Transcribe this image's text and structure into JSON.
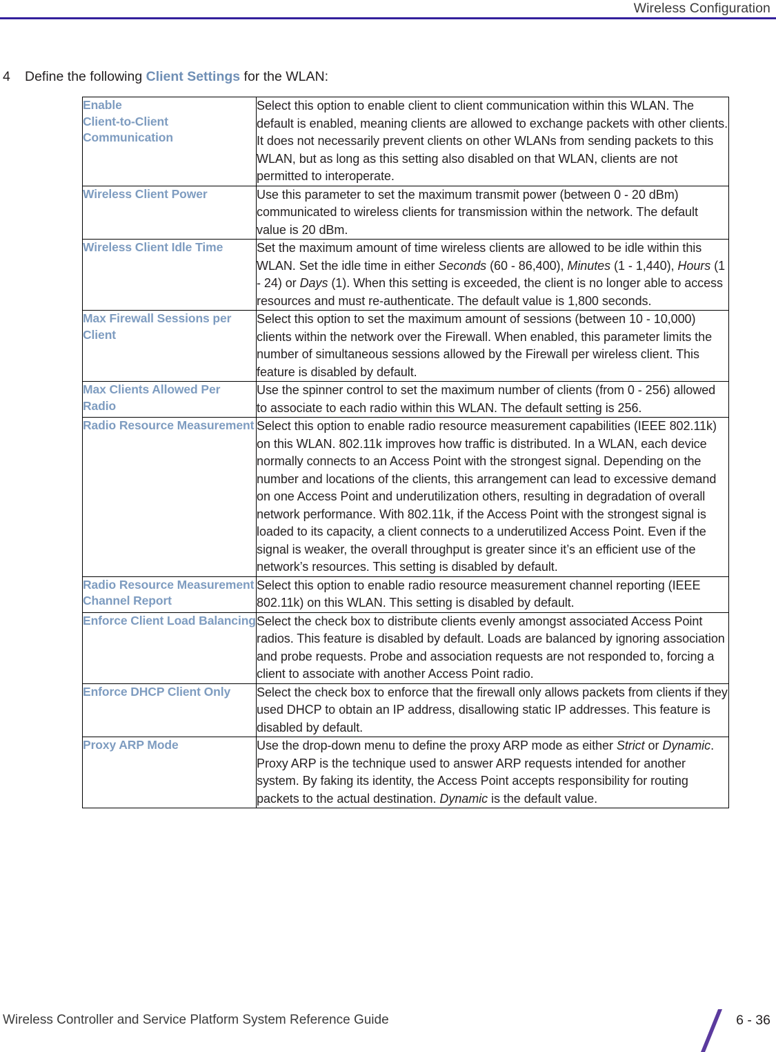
{
  "header": {
    "title": "Wireless Configuration",
    "rule_color": "#33209c"
  },
  "step": {
    "number": "4",
    "text_before": "Define the following ",
    "accent_term": "Client Settings",
    "text_after": " for the WLAN:",
    "accent_color": "#6f8fb5"
  },
  "table": {
    "param_label_color": "#7e9cc0",
    "rows": [
      {
        "param": "Enable\nClient-to-Client\nCommunication",
        "description": "Select this option to enable client to client communication within this WLAN. The default is enabled, meaning clients are allowed to exchange packets with other clients. It does not necessarily prevent clients on other WLANs from sending packets to this WLAN, but as long as this setting also disabled on that WLAN, clients are not permitted to interoperate."
      },
      {
        "param": "Wireless Client Power",
        "description": "Use this parameter to set the maximum transmit power (between 0 - 20 dBm) communicated to wireless clients for transmission within the network. The default value is 20 dBm."
      },
      {
        "param": "Wireless Client Idle Time",
        "description": "Set the maximum amount of time wireless clients are allowed to be idle within this WLAN. Set the idle time in either Seconds (60 - 86,400), Minutes (1 - 1,440), Hours (1 - 24) or Days (1). When this setting is exceeded, the client is no longer able to access resources and must re-authenticate. The default value is 1,800 seconds.",
        "italic_terms": [
          "Seconds",
          "Minutes",
          "Hours",
          "Days"
        ]
      },
      {
        "param": "Max Firewall Sessions per Client",
        "description": "Select this option to set the maximum amount of sessions (between 10 - 10,000) clients within the network over the Firewall. When enabled, this parameter limits the number of simultaneous sessions allowed by the Firewall per wireless client. This feature is disabled by default."
      },
      {
        "param": "Max Clients Allowed Per Radio",
        "description": "Use the spinner control to set the maximum number of clients (from 0 - 256) allowed to associate to each radio within this WLAN. The default setting is 256."
      },
      {
        "param": "Radio Resource Measurement",
        "description": "Select this option to enable radio resource measurement capabilities (IEEE 802.11k) on this WLAN. 802.11k improves how traffic is distributed. In a WLAN, each device normally connects to an Access Point with the strongest signal. Depending on the number and locations of the clients, this arrangement can lead to excessive demand on one Access Point and underutilization others, resulting in degradation of overall network performance. With 802.11k, if the Access Point with the strongest signal is loaded to its capacity, a client connects to a underutilized Access Point. Even if the signal is weaker, the overall throughput is greater since it’s an efficient use of the network’s resources. This setting is disabled by default."
      },
      {
        "param": "Radio Resource Measurement Channel Report",
        "description": "Select this option to enable radio resource measurement channel reporting (IEEE 802.11k) on this WLAN. This setting is disabled by default."
      },
      {
        "param": "Enforce Client Load Balancing",
        "description": "Select the check box to distribute clients evenly amongst associated Access Point radios. This feature is disabled by default. Loads are balanced by ignoring association and probe requests. Probe and association requests are not responded to, forcing a client to associate with another Access Point radio."
      },
      {
        "param": "Enforce DHCP Client Only",
        "description": "Select the check box to enforce that the firewall only allows packets from clients if they used DHCP to obtain an IP address, disallowing static IP addresses. This feature is disabled by default."
      },
      {
        "param": "Proxy ARP Mode",
        "description": "Use the drop-down menu to define the proxy ARP mode as either Strict or Dynamic. Proxy ARP is the technique used to answer ARP requests intended for another system. By faking its identity, the Access Point accepts responsibility for routing packets to the actual destination. Dynamic is the default value.",
        "italic_terms": [
          "Strict",
          "Dynamic"
        ]
      }
    ]
  },
  "footer": {
    "guide_title": "Wireless Controller and Service Platform System Reference Guide",
    "page_number": "6 - 36",
    "slash_color": "#5b3a9e"
  }
}
